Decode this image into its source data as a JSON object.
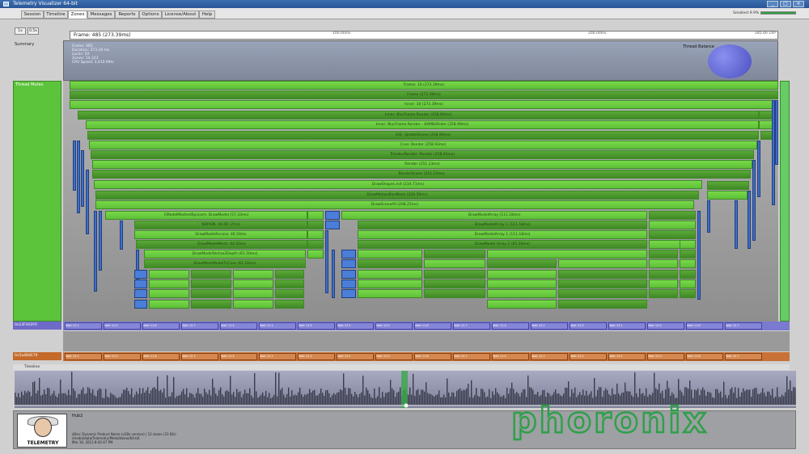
{
  "window": {
    "title": "Telemetry Visualizer 64-bit"
  },
  "tabs": [
    "Session",
    "Timeline",
    "Zones",
    "Messages",
    "Reports",
    "Options",
    "License/About",
    "Help"
  ],
  "active_tab": "Zones",
  "header": {
    "fps_label": "Smallest 9.9%"
  },
  "zoom": {
    "btn1": "1x",
    "btn2": "0.5x"
  },
  "frame": {
    "label": "Frame: 485 (273.39ms)",
    "tick_left": "2",
    "tick_mid1": "100.00ms",
    "tick_mid2": "200.00ms",
    "tick_right": "285.00 1XP"
  },
  "summary": {
    "label": "Summary",
    "info": [
      "Frame: 485",
      "Duration: 273.39 ms",
      "Locks: 10",
      "Zones: 14,323",
      "CPU Speed: 3,410 MHz"
    ],
    "thread_balance": "Thread Balance"
  },
  "threads": {
    "main": "Thread Mutex",
    "lock1": "0x13F402F0",
    "lock2": "0x5a4B4E70"
  },
  "zones": [
    "Frame: 10 (273.39ms)",
    "Frame (273.39ms)",
    "Inner: 10 (273.39ms)",
    "Inner: BlurFrame.Render (258.60ms)",
    "Inner: BlurFrame.Render - 64MBd0rder (258.99ms)",
    "IOS: UpdateScene (258.96ms)",
    "Crve: Render (258.93ms)",
    "TriIndexRender: Render (258.93ms)",
    "Render (251.13ms)",
    "RenderScene (251.15ms)",
    "DrawShapes.Init (234.71ms)",
    "DrawMotionBlurMesh (228.59ms)",
    "DrawSceneAll (208.25ms)"
  ],
  "subzones": {
    "left": [
      "CModelMeshedSyncom: DrawModel (57.33ms)",
      "NDPAIN: 40.09 (7ms)",
      "DrawModelAccess: 46.50ms",
      "DrawModelMesh: 64.50ms",
      "DrawModelVertex2Depth (61.50ms)",
      "DrawMeshModelTriCore (61.50ms)"
    ],
    "right": [
      "DrawModelArray (111.18ms)",
      "DrawModelArray 1 (111.18ms)",
      "DrawModelArray 1 (111.18ms)",
      "DrawModel Array 2 (65.50ms)"
    ]
  },
  "lock_items": [
    "Wait 13.1",
    "Wait 12.0",
    "Wait 11.8",
    "Wait 12.7",
    "Wait 11.4",
    "Wait 12.1",
    "Wait 12.5"
  ],
  "timeline": {
    "label": "Timeline"
  },
  "bottom": {
    "title": "Hub2",
    "lines": [
      "zDev: Dynamic Product Name (v28x version) | 12 zones (33 IDs)",
      "/media/data/Telemetry/Metal/demo/64-bit",
      "Mar 16, 2012 8:42:47 PM"
    ],
    "logo_text": "TELEMETRY"
  },
  "watermark": "phoronix",
  "colors": {
    "zone_green": "#5ec036",
    "lock_purple": "#7a7ad0",
    "lock_orange": "#c87238",
    "watermark": "#2fa04a"
  }
}
